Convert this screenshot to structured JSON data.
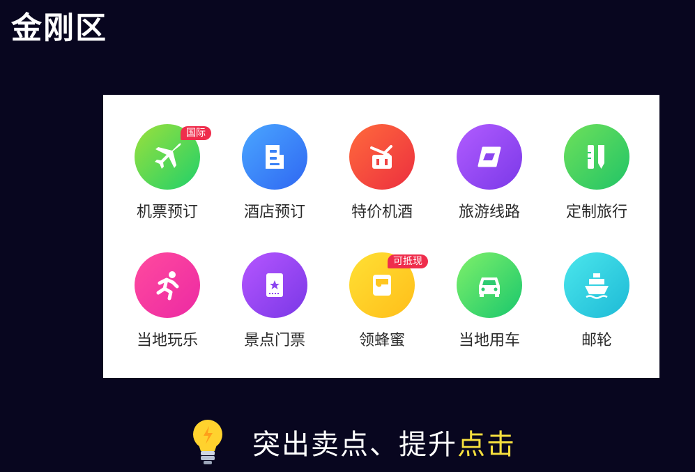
{
  "title": "金刚区",
  "grid": {
    "items": [
      {
        "label": "机票预订",
        "icon": "airplane-icon",
        "badge": "国际",
        "colors": [
          "#9be03c",
          "#20d06a"
        ]
      },
      {
        "label": "酒店预订",
        "icon": "hotel-icon",
        "colors": [
          "#4aa6ff",
          "#2f67f2"
        ]
      },
      {
        "label": "特价机酒",
        "icon": "gift-suitcase-icon",
        "colors": [
          "#ff6a3c",
          "#ec2f3f"
        ]
      },
      {
        "label": "旅游线路",
        "icon": "route-icon",
        "colors": [
          "#b15cff",
          "#7b39e8"
        ]
      },
      {
        "label": "定制旅行",
        "icon": "pen-ruler-icon",
        "colors": [
          "#6ee05a",
          "#21c467"
        ]
      },
      {
        "label": "当地玩乐",
        "icon": "runner-icon",
        "colors": [
          "#ff4a9e",
          "#ec2aa3"
        ]
      },
      {
        "label": "景点门票",
        "icon": "ticket-icon",
        "colors": [
          "#b556ff",
          "#7a38e6"
        ]
      },
      {
        "label": "领蜂蜜",
        "icon": "honey-jar-icon",
        "badge": "可抵现",
        "colors": [
          "#ffe034",
          "#ffbe1a"
        ]
      },
      {
        "label": "当地用车",
        "icon": "car-icon",
        "colors": [
          "#7ff06a",
          "#19c76c"
        ]
      },
      {
        "label": "邮轮",
        "icon": "cruise-ship-icon",
        "colors": [
          "#4be6ec",
          "#1dbad6"
        ]
      }
    ]
  },
  "tagline": {
    "icon": "lightbulb-icon",
    "text": "突出卖点、提升",
    "highlight": "点击",
    "highlight_color": "#f6df3e"
  }
}
